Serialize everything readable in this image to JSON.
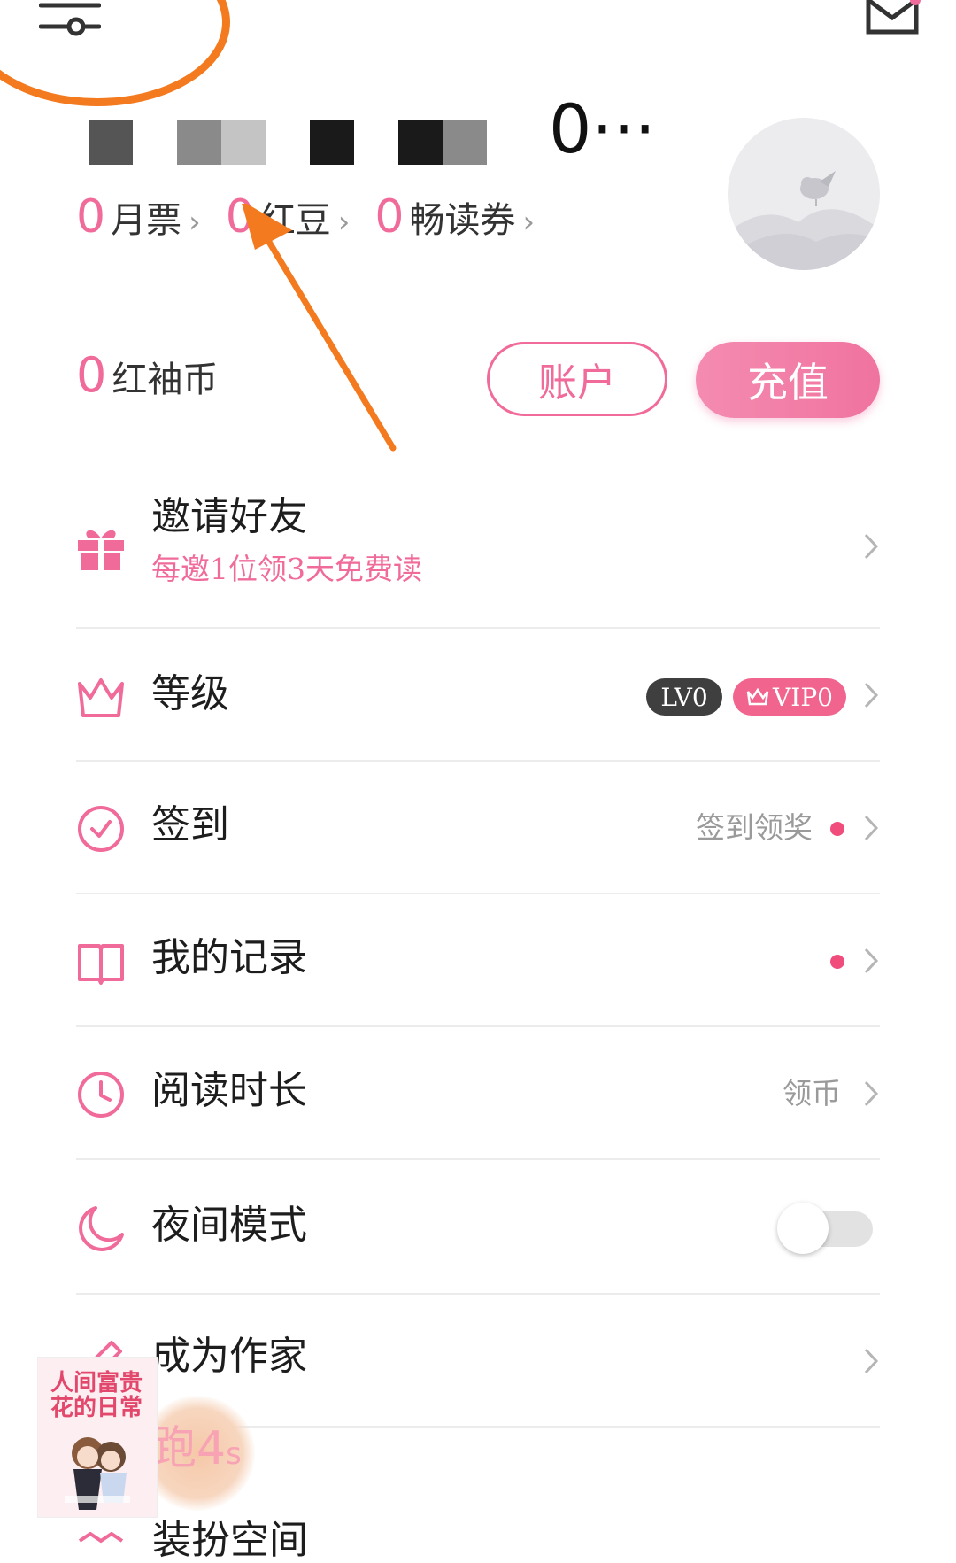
{
  "header": {
    "username_suffix": "0···"
  },
  "stats": [
    {
      "value": "0",
      "label": "月票",
      "arrow": "›"
    },
    {
      "value": "0",
      "label": "红豆",
      "arrow": "›"
    },
    {
      "value": "0",
      "label": "畅读券",
      "arrow": "›"
    }
  ],
  "coins": {
    "value": "0",
    "label": "红袖币"
  },
  "buttons": {
    "account": "账户",
    "recharge": "充值"
  },
  "menu": {
    "invite": {
      "label": "邀请好友",
      "sub": "每邀1位领3天免费读"
    },
    "level": {
      "label": "等级",
      "lv_badge": "LV0",
      "vip_badge": "VIP0"
    },
    "checkin": {
      "label": "签到",
      "right": "签到领奖"
    },
    "records": {
      "label": "我的记录"
    },
    "reading_time": {
      "label": "阅读时长",
      "right": "领币"
    },
    "night_mode": {
      "label": "夜间模式",
      "enabled": false
    },
    "author": {
      "label": "成为作家"
    },
    "bottom_partial": {
      "label": "装扮空间"
    }
  },
  "promo": {
    "book_title": "人间富贵花的日常",
    "timer": "4",
    "timer_unit": "s",
    "timer_prefix": "跑"
  },
  "colors": {
    "accent": "#f06a9a",
    "annotation": "#f47a1f"
  }
}
